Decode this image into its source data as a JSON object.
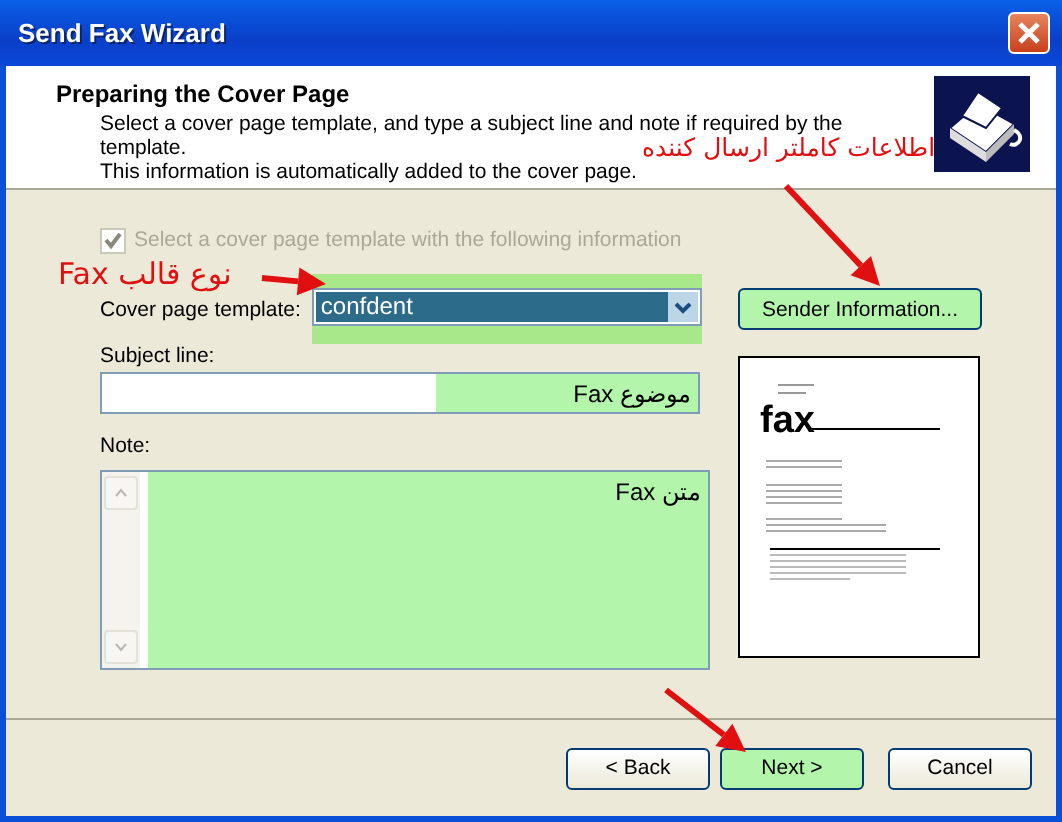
{
  "window": {
    "title": "Send Fax Wizard"
  },
  "header": {
    "title": "Preparing the Cover Page",
    "lines": [
      "Select a cover page template, and type a subject line and note if required by the",
      "template.",
      "This information is automatically added to the cover page."
    ]
  },
  "use_template": {
    "label": "Select a cover page template with the following information",
    "checked": true,
    "disabled": true
  },
  "template": {
    "label": "Cover page template:",
    "value": "confdent",
    "highlighted": true
  },
  "sender_button": {
    "label": "Sender Information...",
    "highlighted": true
  },
  "subject": {
    "label": "Subject line:",
    "value": "موضوع Fax",
    "highlighted": true
  },
  "note": {
    "label": "Note:",
    "value": "متن Fax",
    "highlighted": true
  },
  "preview": {
    "heading": "fax"
  },
  "buttons": [
    {
      "label": "< Back",
      "highlighted": false
    },
    {
      "label": "Next >",
      "highlighted": true
    },
    {
      "label": "Cancel",
      "highlighted": false
    }
  ],
  "annotations": [
    {
      "text": "اطلاعات کاملتر ارسال کننده"
    },
    {
      "text": "نوع قالب Fax"
    }
  ]
}
